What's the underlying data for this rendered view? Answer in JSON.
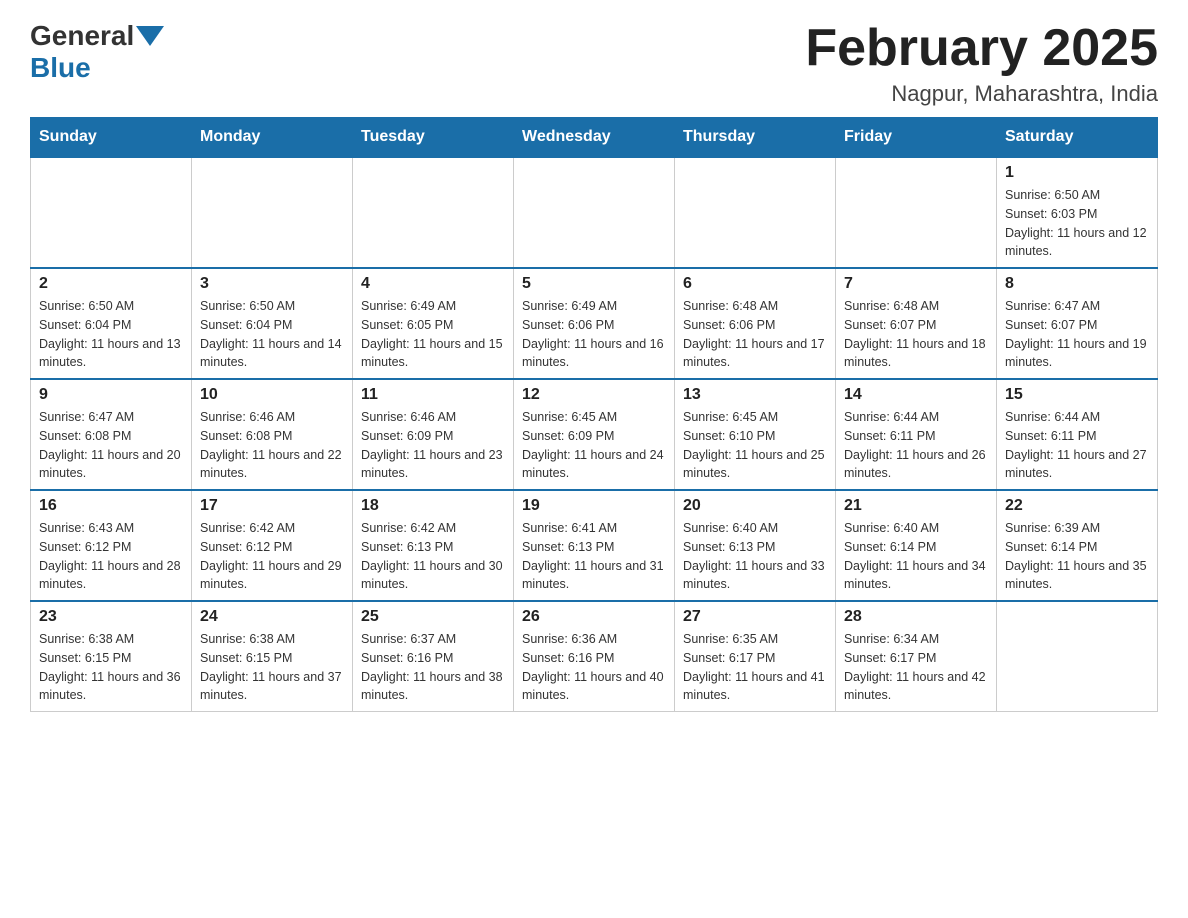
{
  "header": {
    "logo": {
      "general": "General",
      "blue": "Blue"
    },
    "title": "February 2025",
    "location": "Nagpur, Maharashtra, India"
  },
  "days_of_week": [
    "Sunday",
    "Monday",
    "Tuesday",
    "Wednesday",
    "Thursday",
    "Friday",
    "Saturday"
  ],
  "weeks": [
    [
      {
        "day": "",
        "info": ""
      },
      {
        "day": "",
        "info": ""
      },
      {
        "day": "",
        "info": ""
      },
      {
        "day": "",
        "info": ""
      },
      {
        "day": "",
        "info": ""
      },
      {
        "day": "",
        "info": ""
      },
      {
        "day": "1",
        "info": "Sunrise: 6:50 AM\nSunset: 6:03 PM\nDaylight: 11 hours and 12 minutes."
      }
    ],
    [
      {
        "day": "2",
        "info": "Sunrise: 6:50 AM\nSunset: 6:04 PM\nDaylight: 11 hours and 13 minutes."
      },
      {
        "day": "3",
        "info": "Sunrise: 6:50 AM\nSunset: 6:04 PM\nDaylight: 11 hours and 14 minutes."
      },
      {
        "day": "4",
        "info": "Sunrise: 6:49 AM\nSunset: 6:05 PM\nDaylight: 11 hours and 15 minutes."
      },
      {
        "day": "5",
        "info": "Sunrise: 6:49 AM\nSunset: 6:06 PM\nDaylight: 11 hours and 16 minutes."
      },
      {
        "day": "6",
        "info": "Sunrise: 6:48 AM\nSunset: 6:06 PM\nDaylight: 11 hours and 17 minutes."
      },
      {
        "day": "7",
        "info": "Sunrise: 6:48 AM\nSunset: 6:07 PM\nDaylight: 11 hours and 18 minutes."
      },
      {
        "day": "8",
        "info": "Sunrise: 6:47 AM\nSunset: 6:07 PM\nDaylight: 11 hours and 19 minutes."
      }
    ],
    [
      {
        "day": "9",
        "info": "Sunrise: 6:47 AM\nSunset: 6:08 PM\nDaylight: 11 hours and 20 minutes."
      },
      {
        "day": "10",
        "info": "Sunrise: 6:46 AM\nSunset: 6:08 PM\nDaylight: 11 hours and 22 minutes."
      },
      {
        "day": "11",
        "info": "Sunrise: 6:46 AM\nSunset: 6:09 PM\nDaylight: 11 hours and 23 minutes."
      },
      {
        "day": "12",
        "info": "Sunrise: 6:45 AM\nSunset: 6:09 PM\nDaylight: 11 hours and 24 minutes."
      },
      {
        "day": "13",
        "info": "Sunrise: 6:45 AM\nSunset: 6:10 PM\nDaylight: 11 hours and 25 minutes."
      },
      {
        "day": "14",
        "info": "Sunrise: 6:44 AM\nSunset: 6:11 PM\nDaylight: 11 hours and 26 minutes."
      },
      {
        "day": "15",
        "info": "Sunrise: 6:44 AM\nSunset: 6:11 PM\nDaylight: 11 hours and 27 minutes."
      }
    ],
    [
      {
        "day": "16",
        "info": "Sunrise: 6:43 AM\nSunset: 6:12 PM\nDaylight: 11 hours and 28 minutes."
      },
      {
        "day": "17",
        "info": "Sunrise: 6:42 AM\nSunset: 6:12 PM\nDaylight: 11 hours and 29 minutes."
      },
      {
        "day": "18",
        "info": "Sunrise: 6:42 AM\nSunset: 6:13 PM\nDaylight: 11 hours and 30 minutes."
      },
      {
        "day": "19",
        "info": "Sunrise: 6:41 AM\nSunset: 6:13 PM\nDaylight: 11 hours and 31 minutes."
      },
      {
        "day": "20",
        "info": "Sunrise: 6:40 AM\nSunset: 6:13 PM\nDaylight: 11 hours and 33 minutes."
      },
      {
        "day": "21",
        "info": "Sunrise: 6:40 AM\nSunset: 6:14 PM\nDaylight: 11 hours and 34 minutes."
      },
      {
        "day": "22",
        "info": "Sunrise: 6:39 AM\nSunset: 6:14 PM\nDaylight: 11 hours and 35 minutes."
      }
    ],
    [
      {
        "day": "23",
        "info": "Sunrise: 6:38 AM\nSunset: 6:15 PM\nDaylight: 11 hours and 36 minutes."
      },
      {
        "day": "24",
        "info": "Sunrise: 6:38 AM\nSunset: 6:15 PM\nDaylight: 11 hours and 37 minutes."
      },
      {
        "day": "25",
        "info": "Sunrise: 6:37 AM\nSunset: 6:16 PM\nDaylight: 11 hours and 38 minutes."
      },
      {
        "day": "26",
        "info": "Sunrise: 6:36 AM\nSunset: 6:16 PM\nDaylight: 11 hours and 40 minutes."
      },
      {
        "day": "27",
        "info": "Sunrise: 6:35 AM\nSunset: 6:17 PM\nDaylight: 11 hours and 41 minutes."
      },
      {
        "day": "28",
        "info": "Sunrise: 6:34 AM\nSunset: 6:17 PM\nDaylight: 11 hours and 42 minutes."
      },
      {
        "day": "",
        "info": ""
      }
    ]
  ]
}
